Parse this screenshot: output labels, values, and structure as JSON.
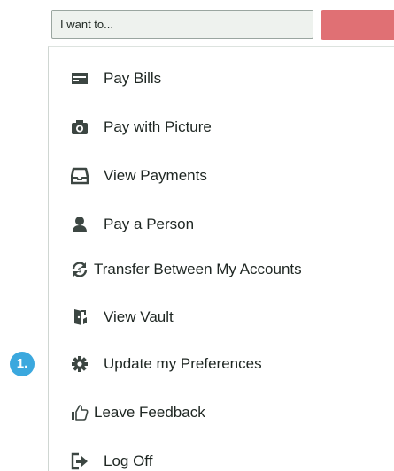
{
  "search": {
    "value": "I want to..."
  },
  "colors": {
    "action_button": "#e07074",
    "badge": "#3ba8de",
    "icon": "#3c4642"
  },
  "step_badge": {
    "label": "1."
  },
  "menu": {
    "items": [
      {
        "label": "Pay Bills",
        "icon": "bill-icon"
      },
      {
        "label": "Pay with Picture",
        "icon": "camera-icon"
      },
      {
        "label": "View Payments",
        "icon": "inbox-icon"
      },
      {
        "label": "Pay a Person",
        "icon": "person-icon"
      },
      {
        "label": "Transfer Between My Accounts",
        "icon": "transfer-icon"
      },
      {
        "label": "View Vault",
        "icon": "vault-icon"
      },
      {
        "label": "Update my Preferences",
        "icon": "gear-icon"
      },
      {
        "label": "Leave Feedback",
        "icon": "thumbs-up-icon"
      },
      {
        "label": "Log Off",
        "icon": "log-off-icon"
      }
    ]
  }
}
